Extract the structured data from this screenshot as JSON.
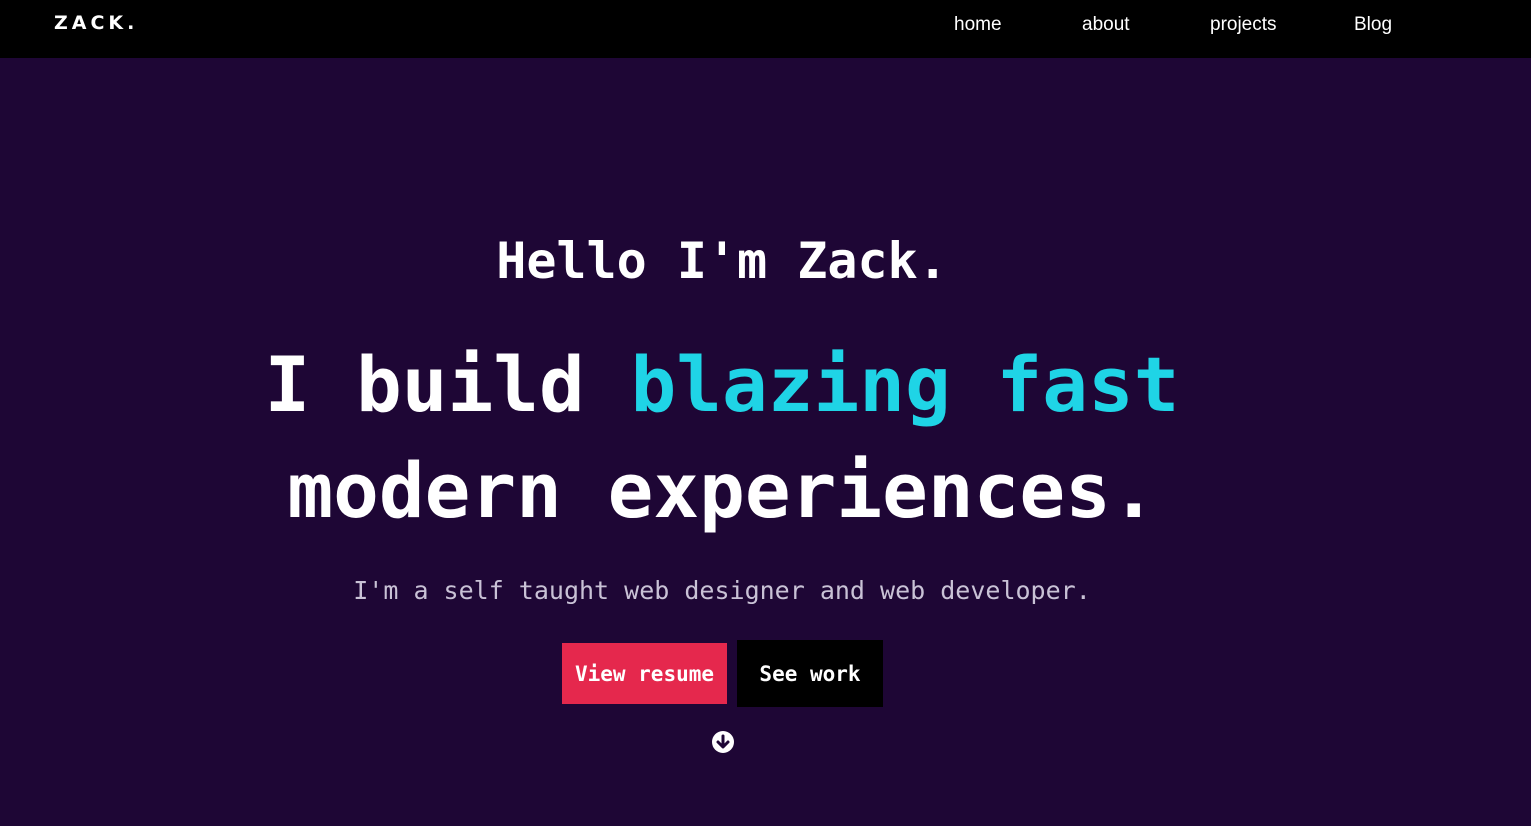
{
  "navbar": {
    "logo": "ZACK.",
    "links": [
      "home",
      "about",
      "projects",
      "Blog"
    ]
  },
  "hero": {
    "greeting": "Hello I'm Zack.",
    "headline_part1": "I build ",
    "headline_highlight": "blazing fast",
    "headline_line2": "modern experiences.",
    "subtitle": "I'm a self taught web designer and web developer.",
    "resume_button": "View resume",
    "work_button": "See work",
    "scroll_icon": "arrow-down-circle-icon"
  },
  "colors": {
    "background": "#1e0635",
    "navbar": "#000000",
    "accent": "#1fd4e6",
    "resume_button": "#e5284d",
    "work_button": "#000000",
    "text": "#ffffff"
  }
}
